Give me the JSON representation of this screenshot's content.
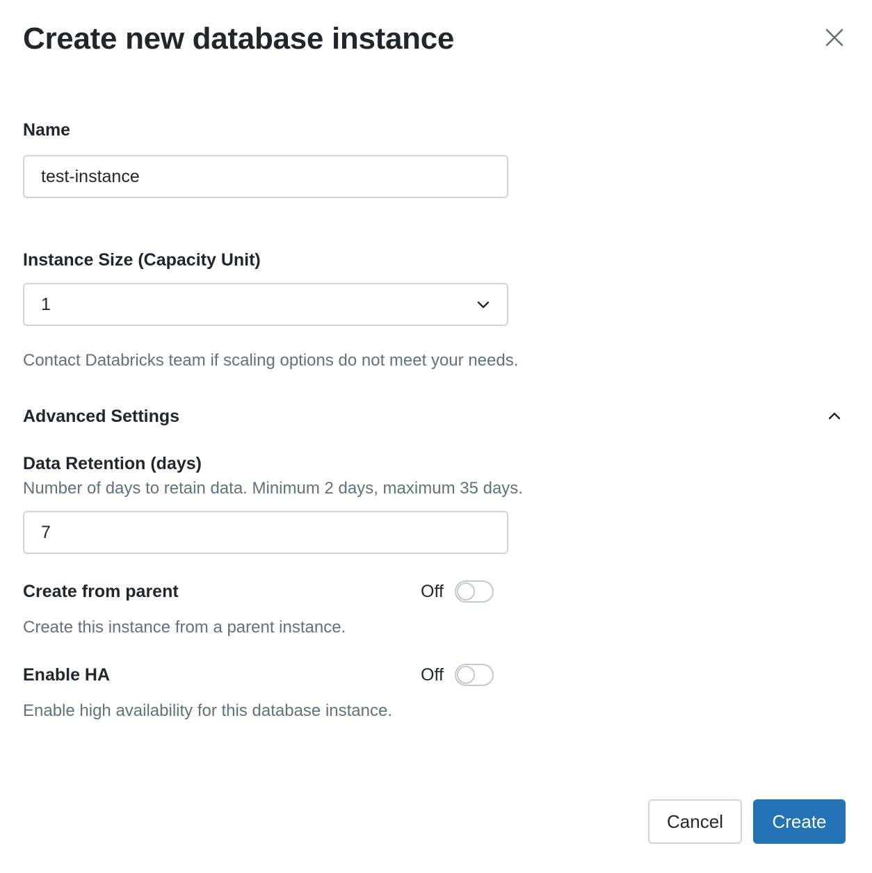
{
  "dialog": {
    "title": "Create new database instance"
  },
  "name": {
    "label": "Name",
    "value": "test-instance"
  },
  "instance_size": {
    "label": "Instance Size (Capacity Unit)",
    "value": "1",
    "help": "Contact Databricks team if scaling options do not meet your needs."
  },
  "advanced": {
    "label": "Advanced Settings",
    "expanded": true
  },
  "data_retention": {
    "label": "Data Retention (days)",
    "help": "Number of days to retain data. Minimum 2 days, maximum 35 days.",
    "value": "7"
  },
  "create_from_parent": {
    "label": "Create from parent",
    "state_text": "Off",
    "help": "Create this instance from a parent instance."
  },
  "enable_ha": {
    "label": "Enable HA",
    "state_text": "Off",
    "help": "Enable high availability for this database instance."
  },
  "footer": {
    "cancel_label": "Cancel",
    "create_label": "Create"
  },
  "colors": {
    "primary": "#2272b4",
    "help_text": "#5f7281",
    "border": "#cdd4da"
  }
}
